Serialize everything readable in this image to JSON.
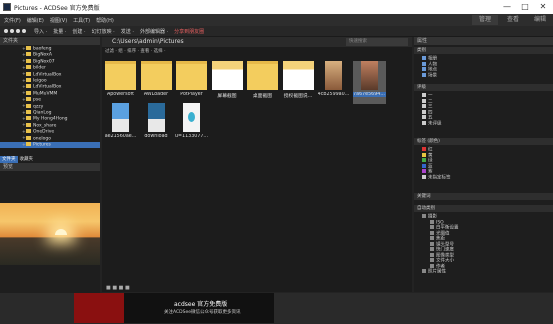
{
  "window": {
    "title": "Pictures - ACDSee 官方免费版",
    "min": "—",
    "max": "□",
    "close": "✕"
  },
  "menu": [
    "文件(F)",
    "编辑(E)",
    "视图(V)",
    "工具(T)",
    "帮助(H)"
  ],
  "modes": [
    "管理",
    "查看",
    "编辑"
  ],
  "toolbar": [
    "导入 ·",
    "批量 ·",
    "创建 ·",
    "幻灯放映 ·",
    "发送 ·",
    "外部编辑器 ·"
  ],
  "toolbar_red": "分享到朋友圈",
  "folders_title": "文件夹",
  "tree": [
    "baofeng",
    "BigNoxA",
    "BigNox07",
    "bilder",
    "LdVirtualBox",
    "leigoo",
    "LdVirtualBox",
    "MuMuVMM",
    "pse",
    "qzzy",
    "QianLog",
    "My Hong4Hong",
    "Nox_share",
    "OneDrive",
    "onelogo",
    "Pictures"
  ],
  "tabs": [
    "文件夹",
    "收藏夹"
  ],
  "preview_title": "预览",
  "path": "C:\\Users\\admin\\Pictures",
  "search_placeholder": "快速搜索",
  "filters": "过滤 · 组 · 排序 · 查看 · 选择 ·",
  "thumbs": [
    {
      "label": "Apowersoft",
      "kind": "folder"
    },
    {
      "label": "AWLoader",
      "kind": "folder"
    },
    {
      "label": "PotPlayer",
      "kind": "folder"
    },
    {
      "label": "屏幕截图",
      "kind": "screen"
    },
    {
      "label": "桌面截图",
      "kind": "folder"
    },
    {
      "label": "授权截图说...",
      "kind": "screen"
    },
    {
      "label": "4cb2599a0...",
      "kind": "portrait"
    },
    {
      "label": "7a67e5694...",
      "kind": "portrait2"
    },
    {
      "label": "ae21560ae...",
      "kind": "doc"
    },
    {
      "label": "download",
      "kind": "doc2"
    },
    {
      "label": "u=1133077...",
      "kind": "feather"
    }
  ],
  "panel_title": "属性",
  "right": {
    "s1": "类别",
    "s1items": [
      "相册",
      "人物",
      "地点",
      "场景"
    ],
    "s2": "评级",
    "s2items": [
      "一",
      "二",
      "三",
      "四",
      "五",
      "未评级"
    ],
    "s3": "标签 (颜色)",
    "s3items": [
      "红",
      "黄",
      "绿",
      "蓝",
      "紫",
      "未指定标签"
    ],
    "s4": "关键词",
    "s5": "自动类别",
    "s5items": [
      "摄影",
      "ISO",
      "白平衡设置",
      "光圈值",
      "焦距",
      "镜头型号",
      "快门速度",
      "图像类型",
      "文件大小",
      "作者",
      "照片属性"
    ]
  },
  "ad": {
    "title": "acdsee 官方免费版",
    "sub": "关注ACDSee微信公众号获取更多资讯"
  },
  "colors": {
    "select": "#3a6fb6",
    "label_colors": [
      "#d33",
      "#e8c640",
      "#4a4",
      "#36c",
      "#a4c"
    ]
  }
}
